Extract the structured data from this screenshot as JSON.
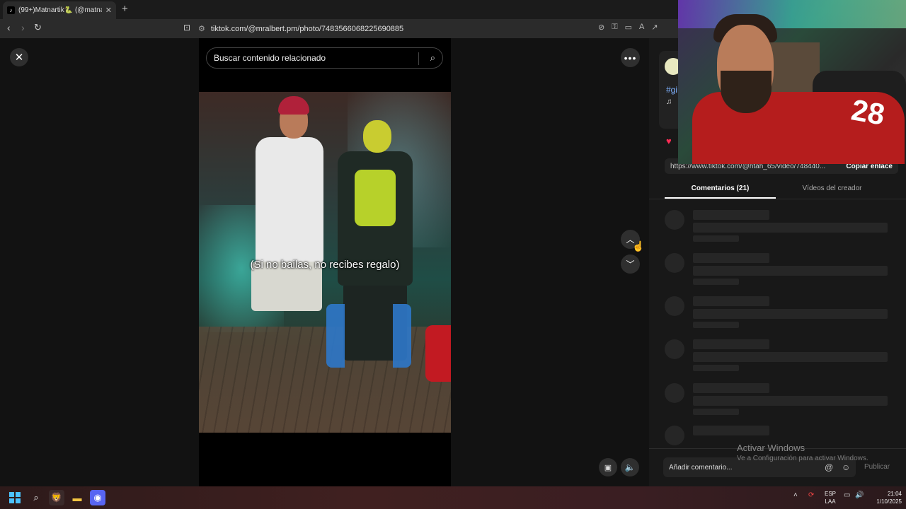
{
  "browser": {
    "tab_title": "(99+)Matnartik🐍 (@matnar",
    "tab_favicon": "tiktok-icon",
    "url": "tiktok.com/@mralbert.pm/photo/7483566068225690885"
  },
  "search": {
    "placeholder": "Buscar contenido relacionado"
  },
  "video": {
    "caption": "(Si no bailas, no recibes regalo)"
  },
  "panel": {
    "hashtag": "#gi",
    "music_icon": "♫",
    "share_link": "https://www.tiktok.com/@htah_65/video/748440...",
    "copy_link_label": "Copiar enlace",
    "tabs": [
      {
        "label": "Comentarios (21)",
        "active": true
      },
      {
        "label": "Vídeos del creador",
        "active": false
      }
    ],
    "comment_placeholder": "Añadir comentario...",
    "publish_label": "Publicar"
  },
  "watermark": {
    "title": "Activar Windows",
    "subtitle": "Ve a Configuración para activar Windows."
  },
  "webcam": {
    "jersey_number": "28"
  },
  "taskbar": {
    "language": [
      "ESP",
      "LAA"
    ],
    "time": "21:04",
    "date": "1/10/2025"
  },
  "colors": {
    "accent_like": "#fe2c55",
    "link": "#7fb2ff"
  }
}
